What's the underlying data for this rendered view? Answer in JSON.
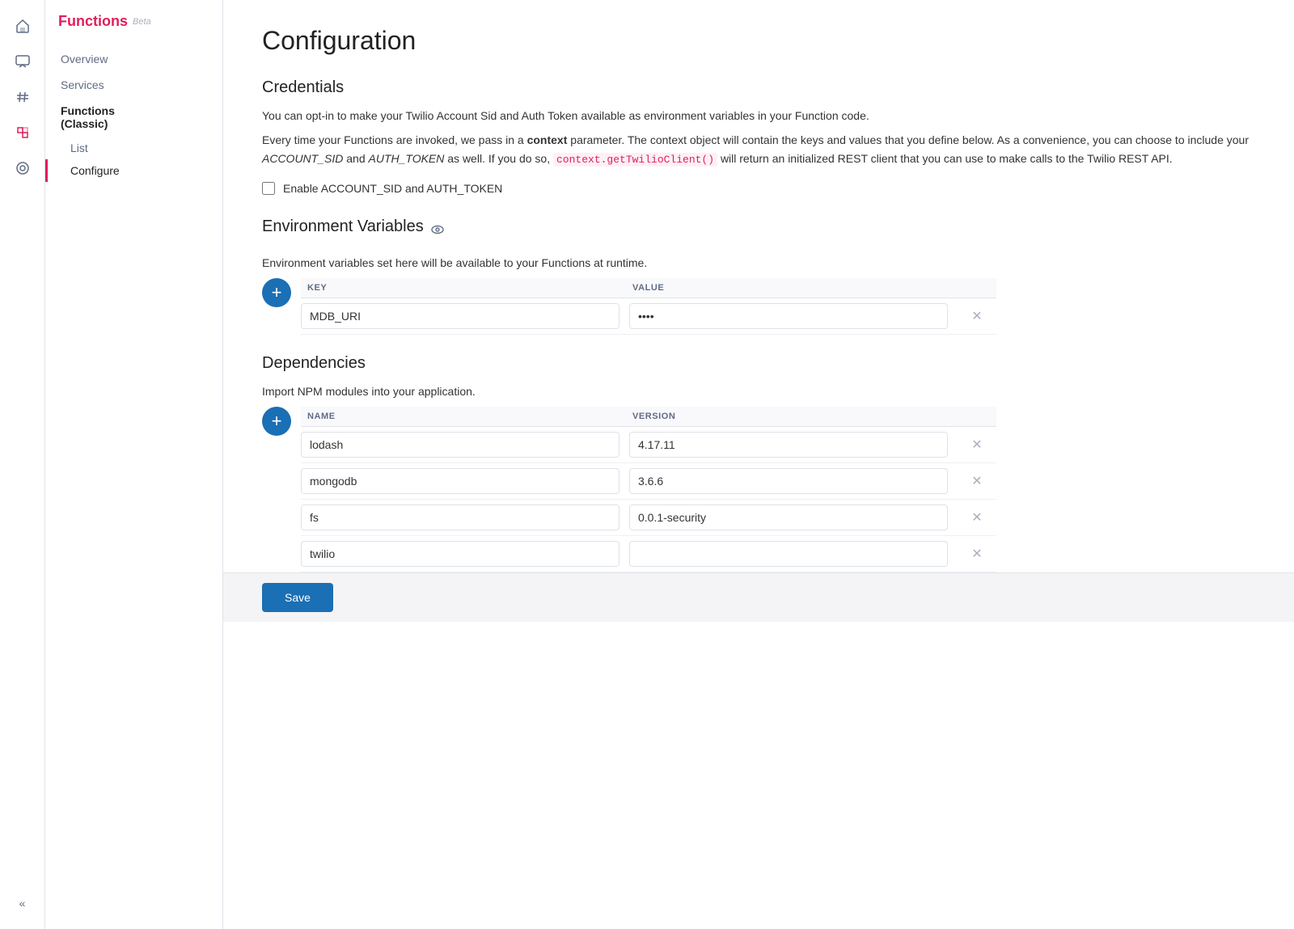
{
  "brand": {
    "name": "Functions",
    "badge": "Beta"
  },
  "nav": {
    "overview": "Overview",
    "services": "Services",
    "functions_classic": "Functions\n(Classic)",
    "list": "List",
    "configure": "Configure"
  },
  "page": {
    "title": "Configuration"
  },
  "credentials": {
    "section_title": "Credentials",
    "desc1": "You can opt-in to make your Twilio Account Sid and Auth Token available as environment variables in your Function code.",
    "desc2_prefix": "Every time your Functions are invoked, we pass in a ",
    "desc2_bold": "context",
    "desc2_mid1": " parameter. The context object will contain the keys and values that you define below. As a convenience, you can choose to include your ",
    "desc2_italic1": "ACCOUNT_SID",
    "desc2_mid2": " and ",
    "desc2_italic2": "AUTH_TOKEN",
    "desc2_mid3": " as well. If you do so, ",
    "desc2_code": "context.getTwilioClient()",
    "desc2_end": " will return an initialized REST client that you can use to make calls to the Twilio REST API.",
    "checkbox_label": "Enable ACCOUNT_SID and AUTH_TOKEN"
  },
  "env_vars": {
    "section_title": "Environment Variables",
    "desc": "Environment variables set here will be available to your Functions at runtime.",
    "col_key": "KEY",
    "col_value": "VALUE",
    "rows": [
      {
        "key": "MDB_URI",
        "value": "****"
      }
    ]
  },
  "dependencies": {
    "section_title": "Dependencies",
    "desc": "Import NPM modules into your application.",
    "col_name": "NAME",
    "col_version": "VERSION",
    "rows": [
      {
        "name": "lodash",
        "version": "4.17.11"
      },
      {
        "name": "mongodb",
        "version": "3.6.6"
      },
      {
        "name": "fs",
        "version": "0.0.1-security"
      },
      {
        "name": "twilio",
        "version": ""
      }
    ]
  },
  "buttons": {
    "save": "Save",
    "add": "+"
  },
  "icons": {
    "home": "⌂",
    "chat": "▤",
    "hash": "#",
    "functions": "◩",
    "support": "●",
    "collapse": "«"
  }
}
